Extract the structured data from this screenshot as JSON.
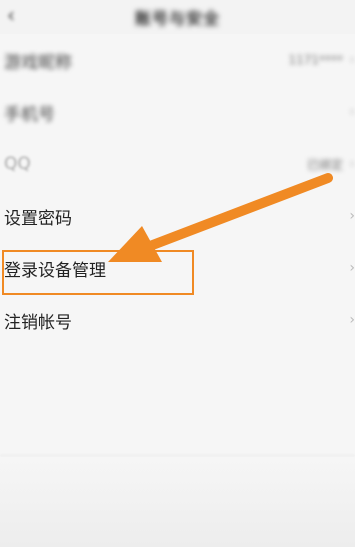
{
  "header": {
    "title": "账号与安全",
    "back_icon": "chevron-left-icon"
  },
  "rows": [
    {
      "label": "游戏昵称",
      "value": "1171****",
      "blurred": true
    },
    {
      "label": "手机号",
      "value": "",
      "blurred": true
    },
    {
      "label": "QQ",
      "value": "已绑定",
      "blurred": true
    },
    {
      "label": "设置密码",
      "value": "",
      "blurred": false
    },
    {
      "label": "登录设备管理",
      "value": "",
      "blurred": false
    },
    {
      "label": "注销帐号",
      "value": "",
      "blurred": false
    }
  ],
  "annotation": {
    "color": "#f08a24",
    "arrow_icon": "orange-arrow-icon"
  }
}
